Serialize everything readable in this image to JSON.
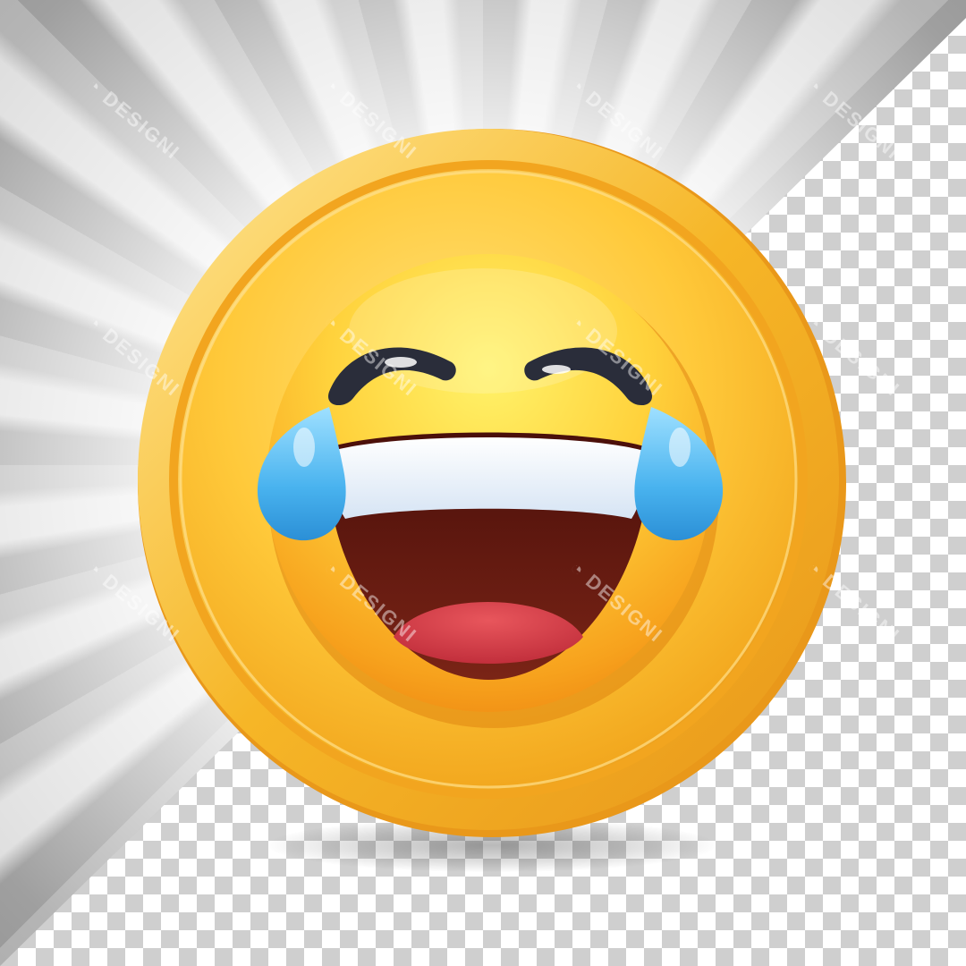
{
  "watermark": {
    "text": "DESIGNI",
    "logo_icon": "d-circle-logo-icon",
    "positions_count": 12
  },
  "emoji": {
    "name": "face-with-tears-of-joy-icon",
    "colors": {
      "coin_outer": "#f4b41f",
      "coin_inner": "#ffd54a",
      "face": "#ffd23c",
      "face_shade": "#f39a1a",
      "eyes": "#2a2d3a",
      "tears": "#4ab4ee",
      "teeth": "#ffffff",
      "mouth": "#6b1b12",
      "tongue": "#d9404a"
    }
  },
  "background": {
    "style": "sunburst-rays-over-transparency-checkerboard"
  }
}
